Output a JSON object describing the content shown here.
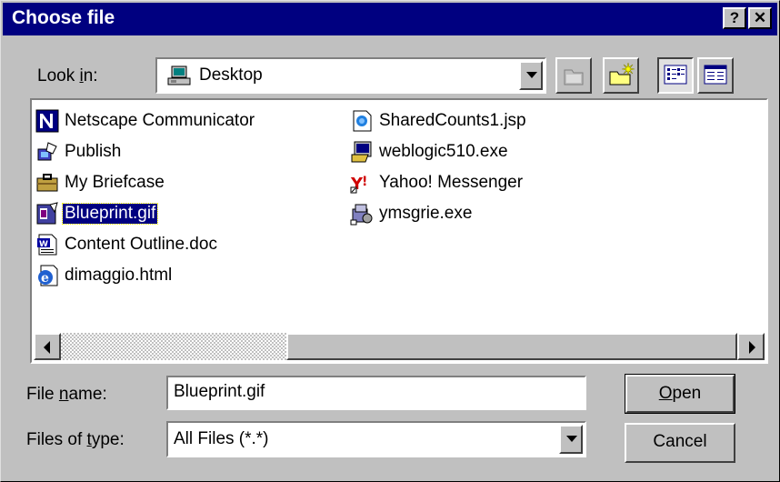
{
  "window": {
    "title": "Choose file",
    "help_label": "?",
    "close_label": "✕"
  },
  "lookin": {
    "label_pre": "Look ",
    "label_key": "i",
    "label_post": "n:",
    "value": "Desktop"
  },
  "files_left": [
    {
      "name": "Netscape Communicator",
      "icon": "netscape-icon"
    },
    {
      "name": "Publish",
      "icon": "publish-icon"
    },
    {
      "name": "My Briefcase",
      "icon": "briefcase-icon"
    },
    {
      "name": "Blueprint.gif",
      "icon": "gif-image-icon",
      "selected": true
    },
    {
      "name": "Content Outline.doc",
      "icon": "word-document-icon"
    },
    {
      "name": "dimaggio.html",
      "icon": "ie-html-icon"
    }
  ],
  "files_right": [
    {
      "name": "SharedCounts1.jsp",
      "icon": "jsp-file-icon"
    },
    {
      "name": "weblogic510.exe",
      "icon": "exe-program-icon"
    },
    {
      "name": "Yahoo! Messenger",
      "icon": "yahoo-messenger-icon"
    },
    {
      "name": "ymsgrie.exe",
      "icon": "installer-icon"
    }
  ],
  "filename": {
    "label_pre": "File ",
    "label_key": "n",
    "label_post": "ame:",
    "value": "Blueprint.gif"
  },
  "filetype": {
    "label_pre": "Files of ",
    "label_key": "t",
    "label_post": "ype:",
    "value": "All Files (*.*)"
  },
  "buttons": {
    "open_key": "O",
    "open_rest": "pen",
    "cancel": "Cancel"
  }
}
